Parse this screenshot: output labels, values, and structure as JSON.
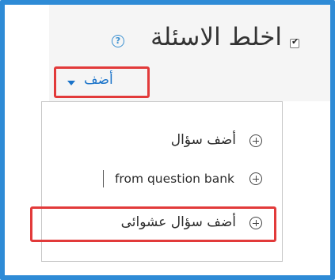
{
  "settings": {
    "shuffle_label": "اخلط الاسئلة",
    "shuffle_checked": true,
    "help_icon": "question-circle-icon"
  },
  "add_menu": {
    "toggle_label": "أضف",
    "items": [
      {
        "label": "أضف سؤال",
        "icon": "plus-circle-icon"
      },
      {
        "label": "from question bank",
        "icon": "plus-circle-icon"
      },
      {
        "label": "أضف سؤال عشوائى",
        "icon": "plus-circle-icon"
      }
    ]
  },
  "colors": {
    "frame_border": "#2e8bd6",
    "highlight": "#e23a3a",
    "link": "#1a73c9"
  }
}
